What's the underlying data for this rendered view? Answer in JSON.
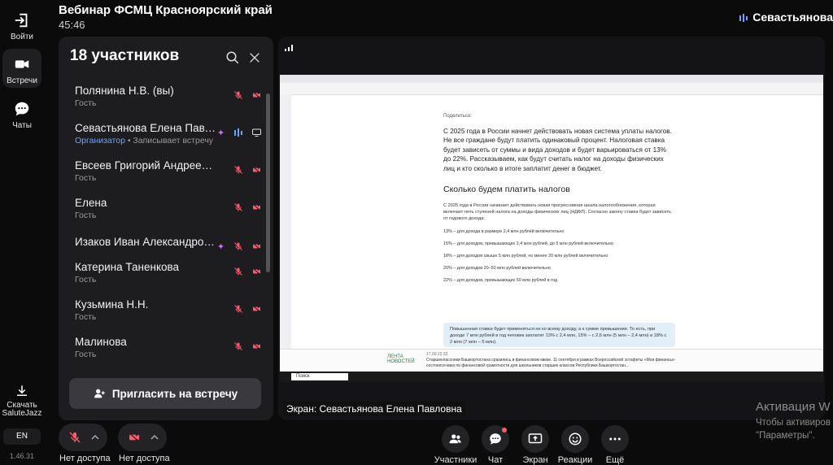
{
  "header": {
    "title": "Вебинар ФСМЦ Красноярский край",
    "time": "45:46",
    "active_speaker": "Севастьянова"
  },
  "rail": {
    "items": [
      {
        "label": "Войти",
        "icon": "login-icon"
      },
      {
        "label": "Встречи",
        "icon": "camera-icon"
      },
      {
        "label": "Чаты",
        "icon": "chat-icon"
      }
    ],
    "download_label": "Скачать SaluteJazz",
    "lang": "EN",
    "version": "1.46.31"
  },
  "participants": {
    "title": "18 участников",
    "invite_label": "Пригласить на встречу",
    "list": [
      {
        "name": "Полянина Н.В. (вы)",
        "role": "Гость"
      },
      {
        "name": "Севастьянова Елена Павловна",
        "role_org": "Организатор",
        "role_extra": " • Записывает встречу"
      },
      {
        "name": "Евсеев Григорий Андреевич",
        "role": "Гость"
      },
      {
        "name": "Елена",
        "role": "Гость"
      },
      {
        "name": "Изаков Иван Александрович",
        "role": ""
      },
      {
        "name": "Катерина Таненкова",
        "role": "Гость"
      },
      {
        "name": "Кузьмина Н.Н.",
        "role": "Гость"
      },
      {
        "name": "Малинова",
        "role": "Гость"
      }
    ]
  },
  "screen": {
    "caption": "Экран: Севастьянова Елена Павловна",
    "article": {
      "share": "Поделиться:",
      "lead": "С 2025 года в России начнет действовать новая система уплаты налогов. Не все граждане будут платить одинаковый процент. Налоговая ставка будет зависеть от суммы и вида доходов и будет варьироваться от 13% до 22%. Рассказываем, как будут считать налог на доходы физических лиц и кто сколько в итоге заплатит денег в бюджет.",
      "h2": "Сколько будем платить налогов",
      "para": "С 2025 года в России начинает действовать новая прогрессивная шкала налогообложения, которая включает пять ступеней налога на доходы физических лиц (НДФЛ). Согласно закону ставка будет зависеть от годового дохода:",
      "items": [
        "13% – для дохода в размере 2,4 млн рублей включительно",
        "15% – для доходов, превышающих 2,4 млн рублей, до 5 млн рублей включительно",
        "18% – для доходов свыше 5 млн рублей, но менее 20 млн рублей включительно",
        "20% – для доходов 20–50 млн рублей включительно",
        "22% – для доходов, превышающих 50 млн рублей в год"
      ],
      "note": "Повышенная ставка будет применяться не ко всему доходу, а к сумме превышения. То есть, при доходе 7 млн рублей в год человек заплатит 13% с 2,4 млн, 15% – с 2,6 млн (5 млн – 2,4 млн) и 18% с 2 млн (7 млн – 5 млн)."
    },
    "news": {
      "brand": "ЛЕНТА НОВОСТЕЙ",
      "date": "17.09 22:33",
      "text": "Старшеклассники Башкортостана сразились в финансовом квизе. 11 сентября в рамках Всероссийской эстафеты «Мои финансы» состоялся квиз по финансовой грамотности для школьников старших классов Республики Башкортостан..."
    },
    "taskbar_search": "Поиск"
  },
  "controls": {
    "mic_label": "Нет доступа",
    "cam_label": "Нет доступа",
    "buttons": [
      {
        "label": "Участники",
        "icon": "participants-icon"
      },
      {
        "label": "Чат",
        "icon": "chat-icon"
      },
      {
        "label": "Экран",
        "icon": "screen-share-icon"
      },
      {
        "label": "Реакции",
        "icon": "reactions-icon"
      },
      {
        "label": "Ещё",
        "icon": "more-icon"
      }
    ]
  },
  "watermark": {
    "title": "Активация W",
    "line1": "Чтобы активиров",
    "line2": "\"Параметры\"."
  },
  "colors": {
    "accent": "#6ba4ff",
    "muted_red": "#ff5a6e",
    "org_sparkle": "#d46bff"
  }
}
